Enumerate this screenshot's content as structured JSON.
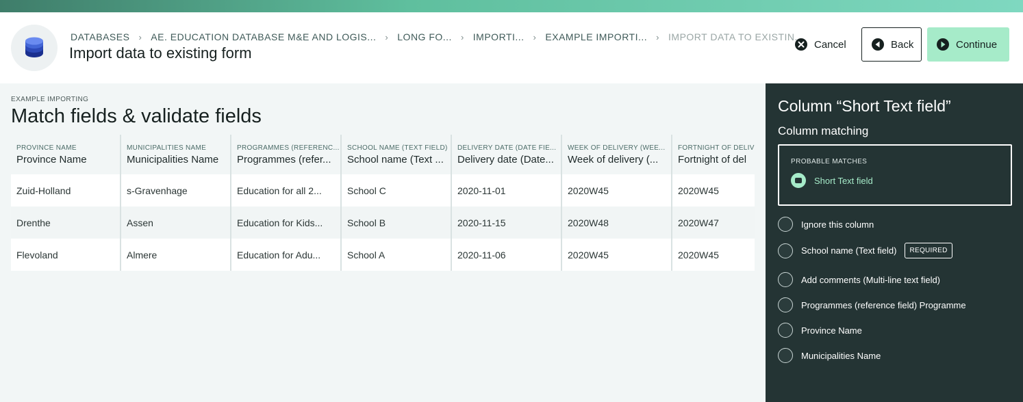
{
  "header": {
    "breadcrumbs": [
      "DATABASES",
      "AE. EDUCATION DATABASE M&E AND LOGIS...",
      "LONG FO...",
      "IMPORTI...",
      "EXAMPLE IMPORTI...",
      "IMPORT DATA TO EXISTIN..."
    ],
    "title": "Import data to existing form",
    "cancel_label": "Cancel",
    "back_label": "Back",
    "continue_label": "Continue",
    "icon": "database-icon"
  },
  "main": {
    "label": "EXAMPLE IMPORTING",
    "title": "Match fields & validate fields",
    "columns": [
      {
        "source": "PROVINCE NAME",
        "field": "Province Name"
      },
      {
        "source": "MUNICIPALITIES NAME",
        "field": "Municipalities Name"
      },
      {
        "source": "PROGRAMMES (REFERENC...",
        "field": "Programmes (refer..."
      },
      {
        "source": "SCHOOL NAME (TEXT FIELD)",
        "field": "School name (Text ..."
      },
      {
        "source": "DELIVERY DATE (DATE FIE...",
        "field": "Delivery date (Date..."
      },
      {
        "source": "WEEK OF DELIVERY (WEE...",
        "field": "Week of delivery (..."
      },
      {
        "source": "FORTNIGHT OF DELIV",
        "field": "Fortnight of del"
      }
    ],
    "rows": [
      [
        "Zuid-Holland",
        "s-Gravenhage",
        "Education for all 2...",
        "School C",
        "2020-11-01",
        "2020W45",
        "2020W45"
      ],
      [
        "Drenthe",
        "Assen",
        "Education for Kids...",
        "School B",
        "2020-11-15",
        "2020W48",
        "2020W47"
      ],
      [
        "Flevoland",
        "Almere",
        "Education for Adu...",
        "School A",
        "2020-11-06",
        "2020W45",
        "2020W45"
      ]
    ]
  },
  "panel": {
    "title": "Column “Short Text field”",
    "subtitle": "Column matching",
    "probable_label": "PROBABLE MATCHES",
    "probable_match": "Short Text field",
    "options": [
      {
        "label": "Ignore this column",
        "badge": ""
      },
      {
        "label": "School name (Text field)",
        "badge": "REQUIRED"
      },
      {
        "label": "Add comments (Multi-line text field)",
        "badge": ""
      },
      {
        "label": "Programmes (reference field) Programme",
        "badge": ""
      },
      {
        "label": "Province Name",
        "badge": ""
      },
      {
        "label": "Municipalities Name",
        "badge": ""
      }
    ]
  },
  "colors": {
    "accent": "#a6ebc9",
    "panel_bg": "#243434",
    "text": "#16201f"
  }
}
